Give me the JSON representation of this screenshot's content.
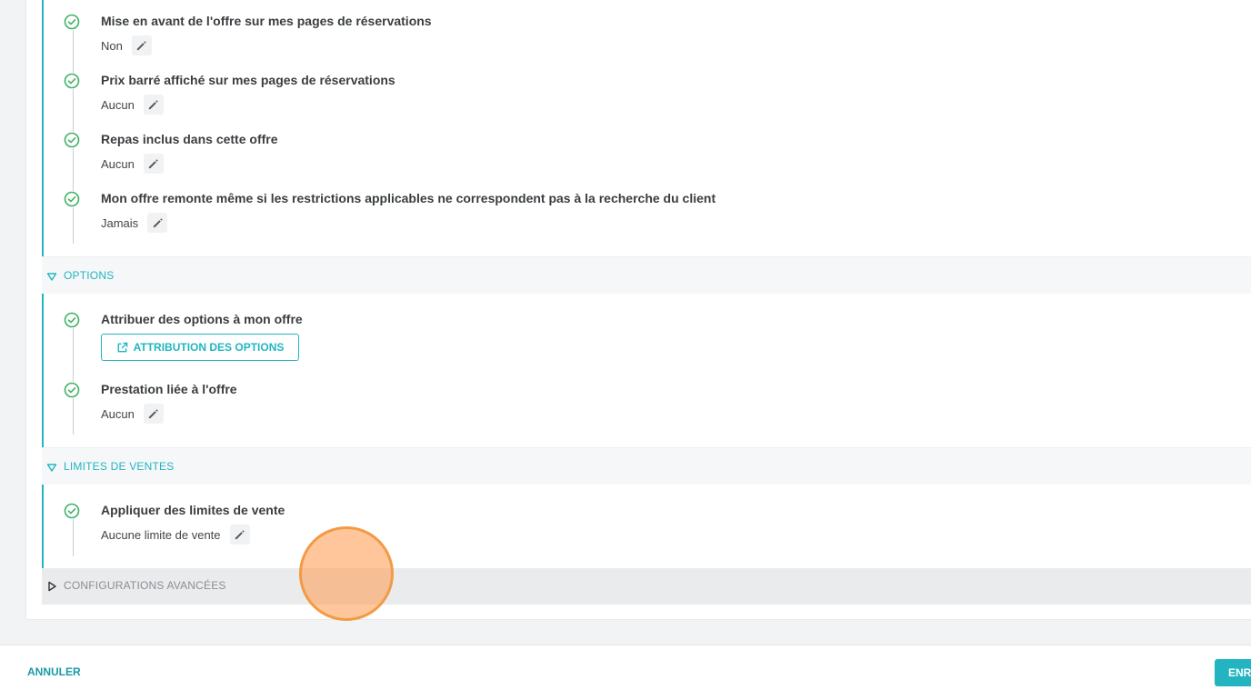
{
  "colors": {
    "accent": "#22b5c1",
    "check": "#3fb263",
    "cursor": "#f39a45"
  },
  "settings": [
    {
      "label": "Mise en avant de l'offre sur mes pages de réservations",
      "value": "Non"
    },
    {
      "label": "Prix barré affiché sur mes pages de réservations",
      "value": "Aucun"
    },
    {
      "label": "Repas inclus dans cette offre",
      "value": "Aucun"
    },
    {
      "label": "Mon offre remonte même si les restrictions applicables ne correspondent pas à la recherche du client",
      "value": "Jamais"
    }
  ],
  "options_section": {
    "title": "OPTIONS",
    "assign_label": "Attribuer des options à mon offre",
    "assign_button": "ATTRIBUTION DES OPTIONS",
    "service_label": "Prestation liée à l'offre",
    "service_value": "Aucun"
  },
  "limits_section": {
    "title": "LIMITES DE VENTES",
    "label": "Appliquer des limites de vente",
    "value": "Aucune limite de vente"
  },
  "advanced_section": {
    "title": "CONFIGURATIONS AVANCÉES"
  },
  "footer": {
    "cancel": "ANNULER",
    "save": "ENREGISTRER"
  },
  "icons": {
    "check": "check-circle-icon",
    "edit": "pencil-icon",
    "external": "external-link-icon",
    "expand": "triangle-down-icon",
    "collapse": "triangle-right-icon"
  }
}
